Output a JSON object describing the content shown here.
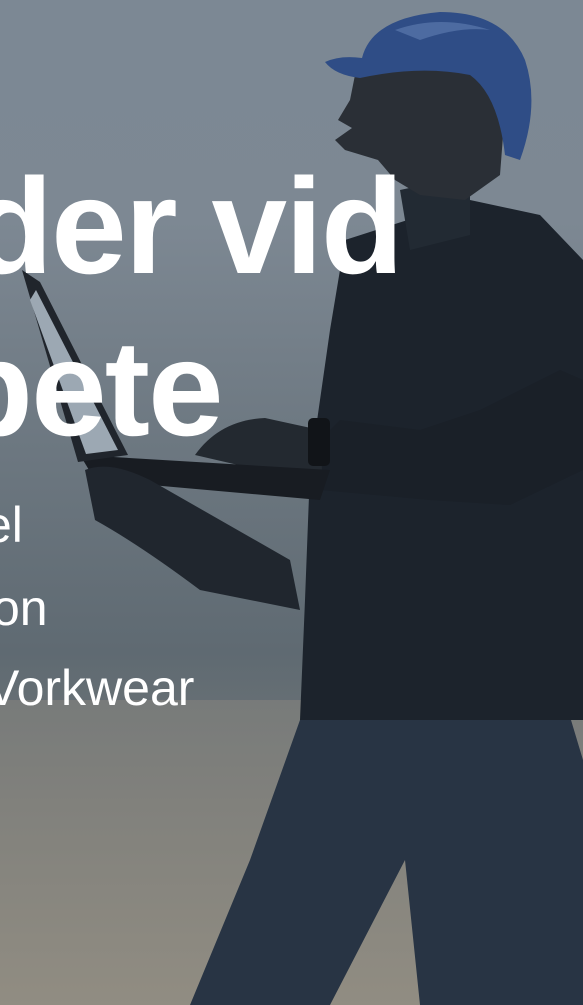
{
  "hero": {
    "headline_line1": "der vid",
    "headline_line2": "bete",
    "sub_line1": "el",
    "sub_line2": "on",
    "sub_line3": "Vorkwear"
  },
  "colors": {
    "sky_top": "#7c8894",
    "sky_bottom": "#8c8a80",
    "helmet": "#2f4d86",
    "silhouette": "#1d232b",
    "text": "#ffffff"
  },
  "icons": {
    "person": "worker-silhouette",
    "helmet": "hard-hat",
    "laptop": "laptop"
  }
}
